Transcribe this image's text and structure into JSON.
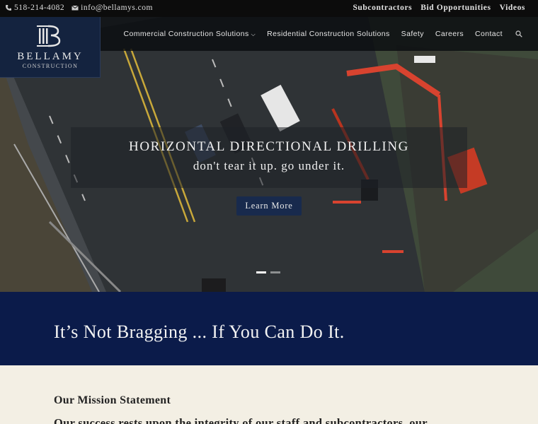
{
  "topbar": {
    "phone": "518-214-4082",
    "email": "info@bellamys.com",
    "links": [
      "Subcontractors",
      "Bid Opportunities",
      "Videos"
    ]
  },
  "logo": {
    "name": "BELLAMY",
    "sub": "CONSTRUCTION"
  },
  "nav": {
    "items": [
      "Commercial Construction Solutions",
      "Residential Construction Solutions",
      "Safety",
      "Careers",
      "Contact"
    ]
  },
  "hero": {
    "title": "HORIZONTAL DIRECTIONAL DRILLING",
    "subtitle": "don't tear it up. go under it.",
    "button": "Learn More",
    "active_slide": 1,
    "slide_count": 2
  },
  "band": {
    "tagline": "It’s Not Bragging ... If You Can Do It."
  },
  "mission": {
    "heading": "Our Mission Statement",
    "text": "Our success rests upon the integrity of our staff and subcontractors, our"
  },
  "colors": {
    "navy": "#0b1b4a",
    "logo_bg": "#14233f",
    "button": "#182a4d",
    "cream": "#f3efe4"
  }
}
